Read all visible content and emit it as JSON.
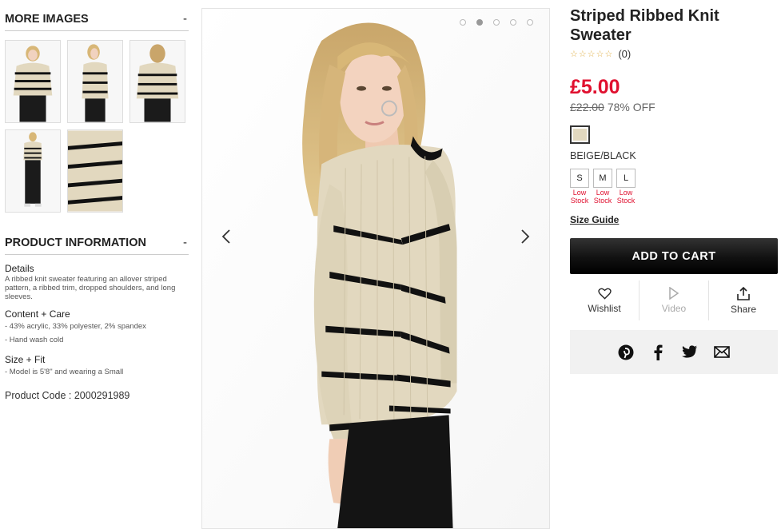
{
  "more_images": {
    "heading": "MORE IMAGES",
    "toggle": "-",
    "thumbnails": [
      "front-view",
      "side-view",
      "back-view",
      "full-length-view",
      "fabric-detail"
    ]
  },
  "product_info": {
    "heading": "PRODUCT INFORMATION",
    "toggle": "-",
    "details_title": "Details",
    "details_text": "A ribbed knit sweater featuring an allover striped pattern, a ribbed trim, dropped shoulders, and long sleeves.",
    "content_title": "Content + Care",
    "content_items": [
      "- 43% acrylic, 33% polyester, 2% spandex",
      "- Hand wash cold"
    ],
    "size_fit_title": "Size + Fit",
    "size_fit_items": [
      "- Model is 5'8\" and wearing a Small"
    ],
    "product_code": "Product Code : 2000291989"
  },
  "gallery": {
    "dots": 5,
    "active_dot": 1,
    "prev_icon": "chevron-left-icon",
    "next_icon": "chevron-right-icon"
  },
  "product": {
    "title": "Striped Ribbed Knit Sweater",
    "stars": "☆☆☆☆☆",
    "rating_count": "(0)",
    "price": "£5.00",
    "old_price": "£22.00",
    "discount": "78% OFF",
    "color_name": "BEIGE/BLACK",
    "swatch_color": "#e2d8bf",
    "sizes": [
      {
        "label": "S",
        "stock": "Low Stock"
      },
      {
        "label": "M",
        "stock": "Low Stock"
      },
      {
        "label": "L",
        "stock": "Low Stock"
      }
    ],
    "size_guide": "Size Guide",
    "add_to_cart": "ADD TO CART",
    "actions": {
      "wishlist": "Wishlist",
      "video": "Video",
      "share": "Share"
    },
    "social_icons": [
      "pinterest-icon",
      "facebook-icon",
      "twitter-icon",
      "email-icon"
    ]
  },
  "colors": {
    "price_red": "#e0102f",
    "stock_red": "#e0102f",
    "cart_black": "#111111",
    "sweater_beige": "#e2d8bf"
  }
}
